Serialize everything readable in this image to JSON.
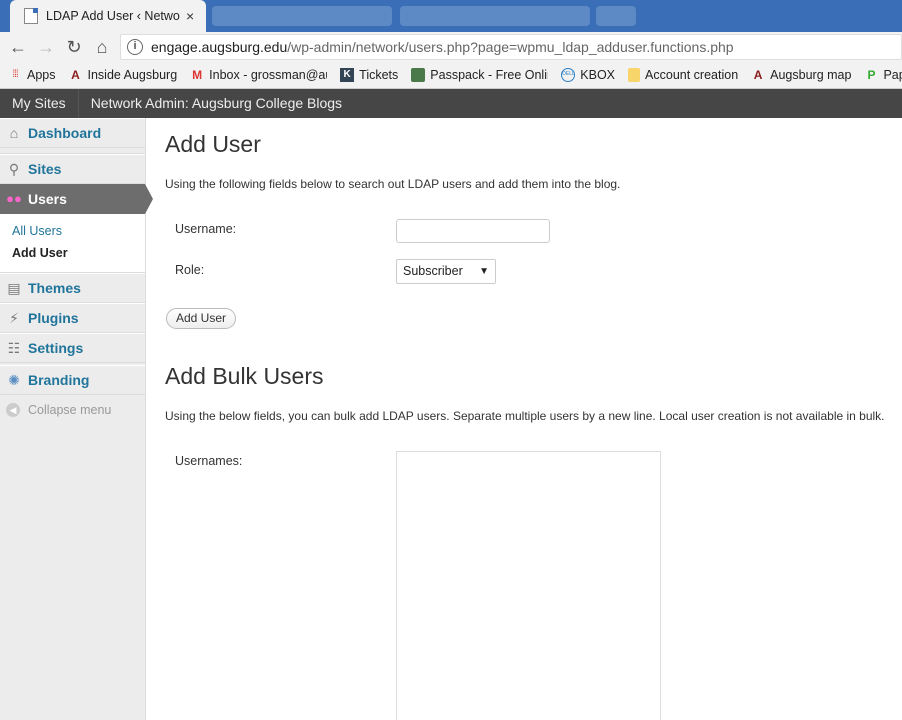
{
  "browser": {
    "tab_title": "LDAP Add User ‹ Network Admin",
    "tab_close": "×",
    "url_host": "engage.augsburg.edu",
    "url_path": "/wp-admin/network/users.php?page=wpmu_ldap_adduser.functions.php",
    "nav": {
      "back": "←",
      "forward": "→",
      "reload": "↻",
      "home": "⌂"
    },
    "info_glyph": "i"
  },
  "bookmarks": [
    {
      "label": "Apps",
      "icon": "apps-grid-icon"
    },
    {
      "label": "Inside Augsburg",
      "icon": "augsburg-a-icon"
    },
    {
      "label": "Inbox - grossman@au",
      "icon": "gmail-icon"
    },
    {
      "label": "Tickets",
      "icon": "k-icon"
    },
    {
      "label": "Passpack - Free Onlin",
      "icon": "passpack-icon"
    },
    {
      "label": "KBOX",
      "icon": "dell-icon"
    },
    {
      "label": "Account creation",
      "icon": "folder-icon"
    },
    {
      "label": "Augsburg map",
      "icon": "augsburg-a-icon"
    },
    {
      "label": "Pape",
      "icon": "green-p-icon"
    }
  ],
  "adminbar": {
    "my_sites": "My Sites",
    "network_admin": "Network Admin: Augsburg College Blogs"
  },
  "sidebar": {
    "dashboard": "Dashboard",
    "sites": "Sites",
    "users": "Users",
    "sub_all_users": "All Users",
    "sub_add_user": "Add User",
    "themes": "Themes",
    "plugins": "Plugins",
    "settings": "Settings",
    "branding": "Branding",
    "collapse": "Collapse menu"
  },
  "add_user": {
    "heading": "Add User",
    "description": "Using the following fields below to search out LDAP users and add them into the blog.",
    "username_label": "Username:",
    "username_value": "",
    "role_label": "Role:",
    "role_value": "Subscriber",
    "submit": "Add User"
  },
  "add_bulk": {
    "heading": "Add Bulk Users",
    "description": "Using the below fields, you can bulk add LDAP users. Separate multiple users by a new line. Local user creation is not available in bulk.",
    "usernames_label": "Usernames:",
    "usernames_value": ""
  },
  "colors": {
    "tabstrip": "#3a6fb8",
    "adminbar": "#464646",
    "link": "#21759b",
    "current_menu": "#6d6d6d"
  }
}
